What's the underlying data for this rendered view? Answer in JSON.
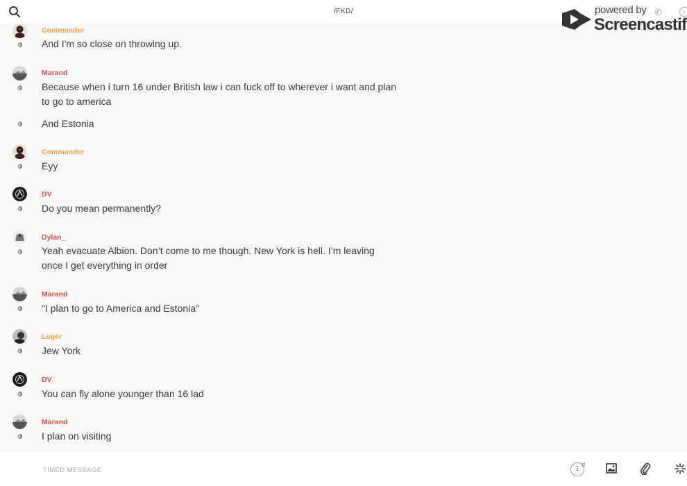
{
  "header": {
    "channel_title": "/FKD/",
    "search_icon": "search-icon"
  },
  "watermark": {
    "powered_by": "powered by",
    "brand": "Screencastify",
    "logo_icon": "screencastify-logo-icon",
    "phone_icon": "phone-icon",
    "info_icon": "info-icon"
  },
  "colors": {
    "commander": "#f0a24a",
    "marand": "#e0514a",
    "dv": "#e0514a",
    "dylan": "#e0514a",
    "luger": "#f0a24a",
    "text": "#3a3a3a",
    "background": "#f8f8f8"
  },
  "messages": [
    {
      "author": "Commander",
      "text": "And I'm so close on throwing up.",
      "avatar": "commander-avatar"
    },
    {
      "author": "Marand",
      "text": "Because when i turn 16 under British law i can fuck off to wherever i want and plan to go to america",
      "avatar": "marand-avatar"
    },
    {
      "author": "",
      "text": "And Estonia",
      "avatar": ""
    },
    {
      "author": "Commander",
      "text": "Eyy",
      "avatar": "commander-avatar"
    },
    {
      "author": "DV",
      "text": "Do you mean permanently?",
      "avatar": "dv-avatar"
    },
    {
      "author": "Dylan_",
      "text": "Yeah evacuate Albion. Don’t come to me though. New York is hell. I’m leaving once I get everything in order",
      "avatar": "dylan-avatar"
    },
    {
      "author": "Marand",
      "text": "\"I plan to go to America and Estonia\"",
      "avatar": "marand-avatar"
    },
    {
      "author": "Luger",
      "text": "Jew York",
      "avatar": "luger-avatar"
    },
    {
      "author": "DV",
      "text": "You can fly alone younger than 16 lad",
      "avatar": "dv-avatar"
    },
    {
      "author": "Marand",
      "text": "I plan on visiting",
      "avatar": "marand-avatar"
    }
  ],
  "composer": {
    "placeholder": "TIMED MESSAGE",
    "timer_value": "1",
    "timer_unit": "d",
    "image_icon": "image-icon",
    "attach_icon": "paperclip-icon",
    "effects_icon": "sparkle-icon"
  }
}
